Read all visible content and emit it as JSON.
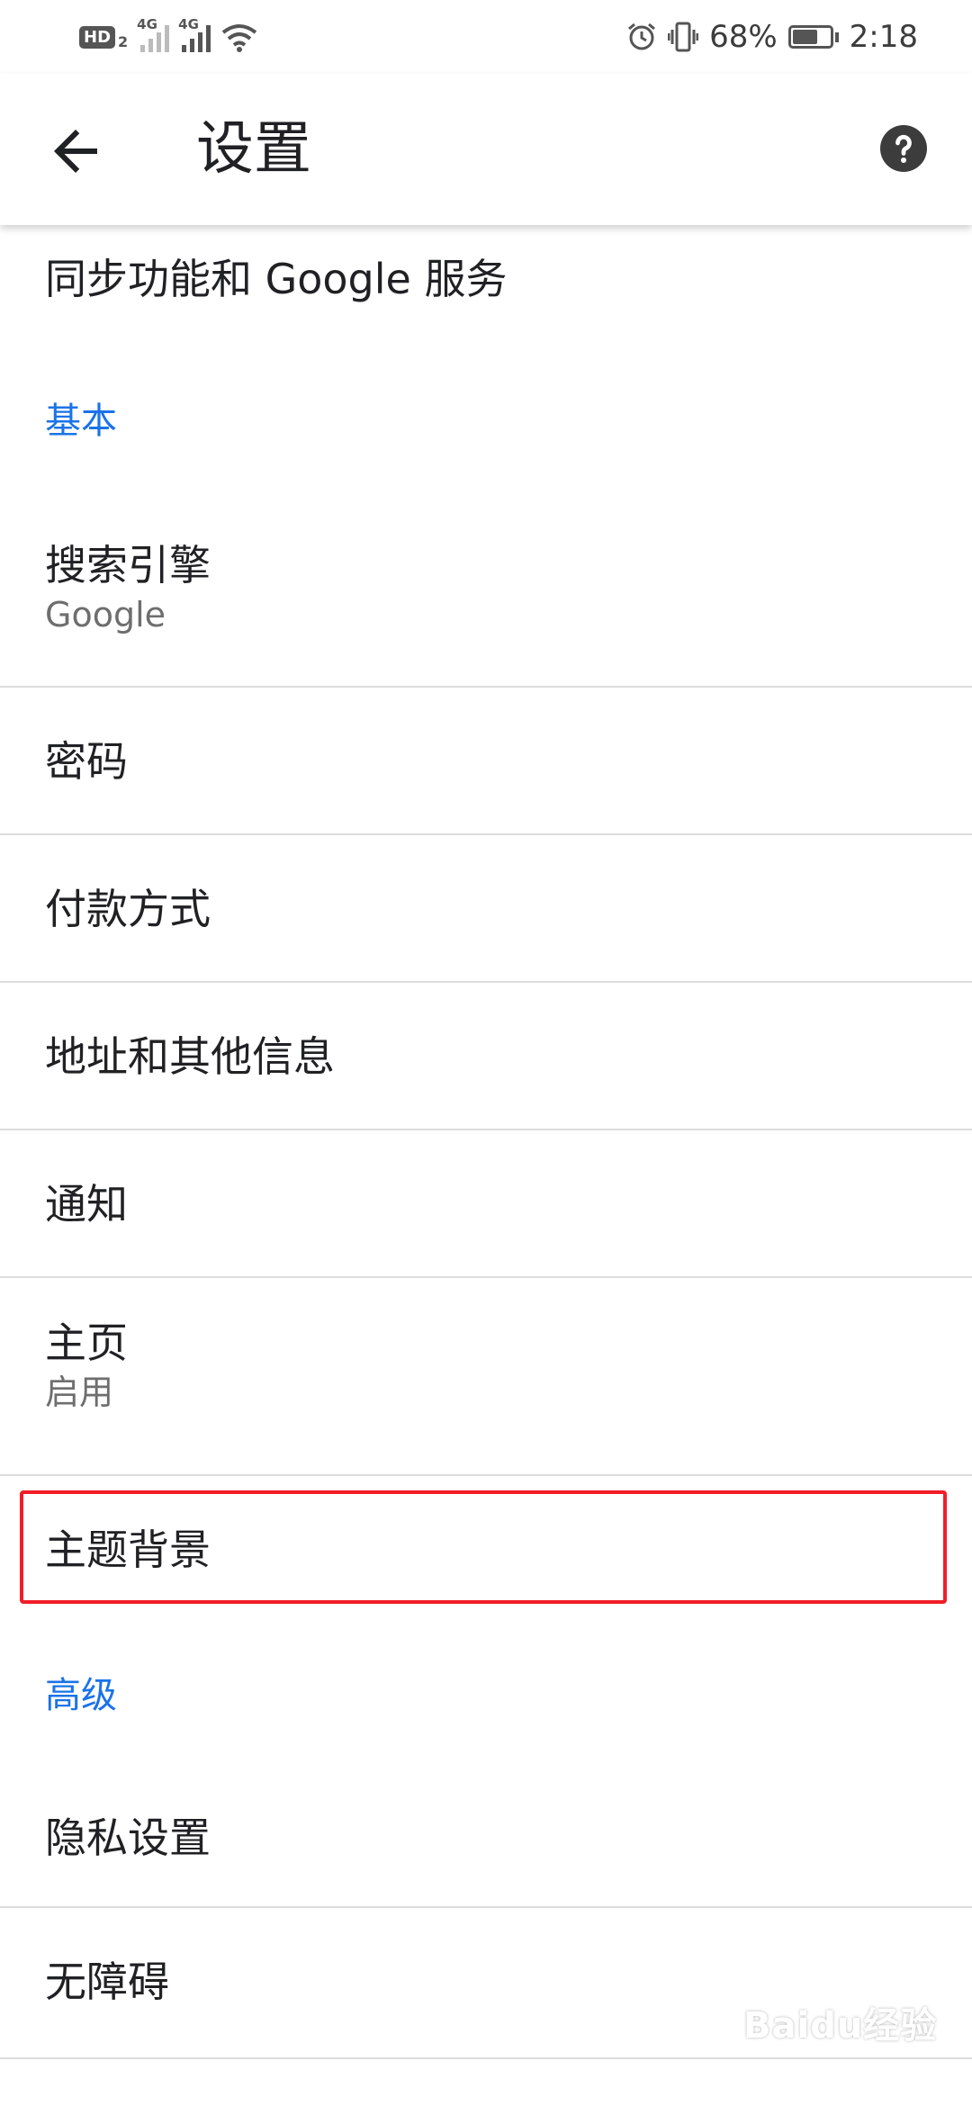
{
  "status_bar": {
    "hd_label": "HD",
    "sim_label": "2",
    "net1": "4G",
    "net2": "4G",
    "battery_percent_text": "68%",
    "battery_level": 0.68,
    "time": "2:18",
    "icons": [
      "hd-icon",
      "signal-icon",
      "signal-icon",
      "wifi-icon",
      "alarm-icon",
      "vibrate-icon",
      "battery-icon"
    ]
  },
  "app_bar": {
    "title": "设置",
    "back_icon": "arrow-left-icon",
    "help_icon": "help-circle-icon"
  },
  "items": {
    "sync": {
      "title": "同步功能和 Google 服务"
    },
    "section_basic": "基本",
    "search_engine": {
      "title": "搜索引擎",
      "subtitle": "Google"
    },
    "passwords": {
      "title": "密码"
    },
    "payment": {
      "title": "付款方式"
    },
    "addresses": {
      "title": "地址和其他信息"
    },
    "notifications": {
      "title": "通知"
    },
    "homepage": {
      "title": "主页",
      "subtitle": "启用"
    },
    "theme": {
      "title": "主题背景"
    },
    "section_advanced": "高级",
    "privacy": {
      "title": "隐私设置"
    },
    "accessibility": {
      "title": "无障碍"
    }
  },
  "watermark": "Baidu经验",
  "colors": {
    "accent": "#1a73e8",
    "highlight": "#f01d28",
    "divider": "#dcdcdc"
  }
}
